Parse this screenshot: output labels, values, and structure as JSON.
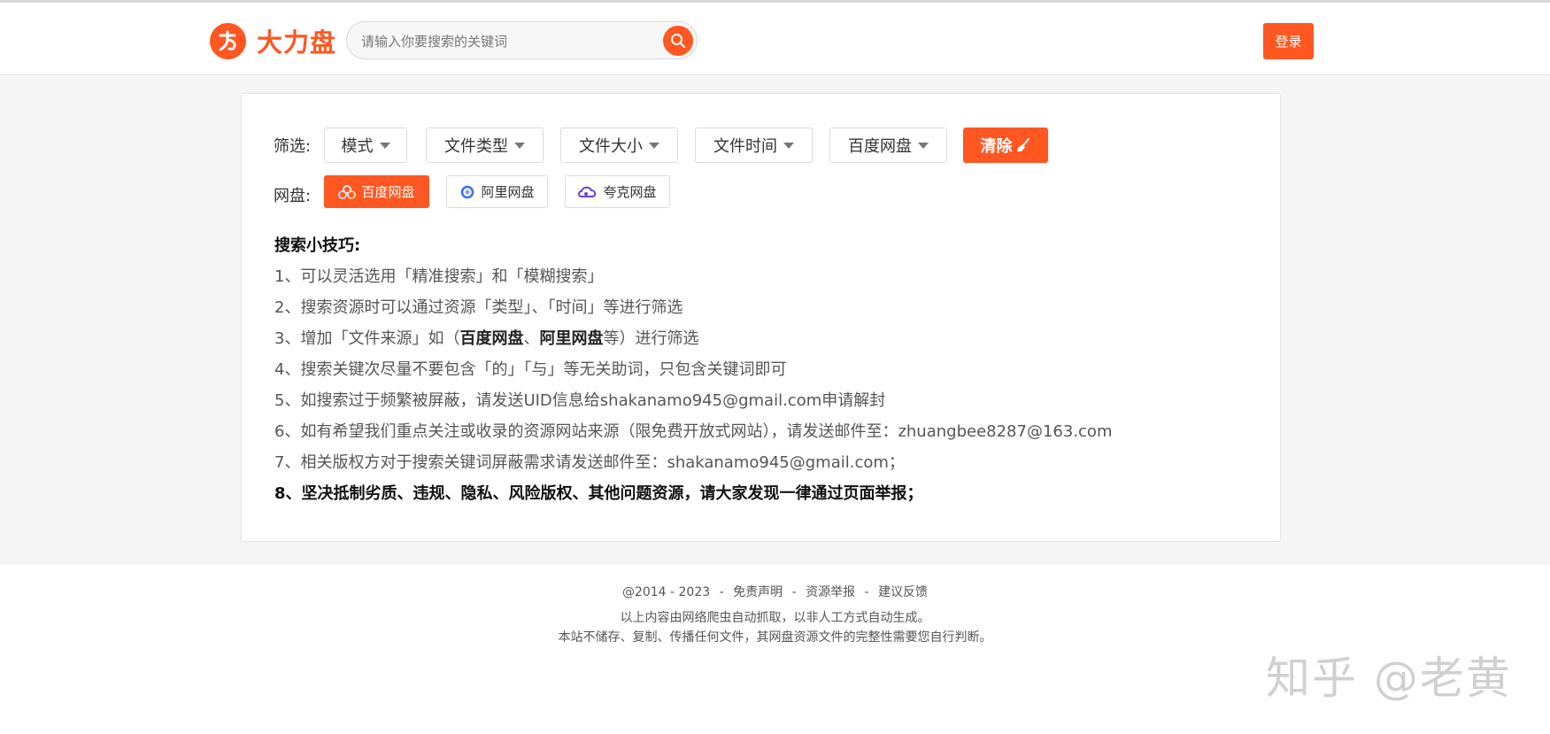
{
  "header": {
    "logo_text": "大力盘",
    "search_placeholder": "请输入你要搜索的关键词",
    "login_label": "登录"
  },
  "filters": {
    "label": "筛选:",
    "dropdowns": [
      "模式",
      "文件类型",
      "文件大小",
      "文件时间",
      "百度网盘"
    ],
    "clear_label": "清除"
  },
  "pan": {
    "label": "网盘:",
    "options": [
      "百度网盘",
      "阿里网盘",
      "夸克网盘"
    ],
    "active": "百度网盘"
  },
  "tips": {
    "title": "搜索小技巧:",
    "items": [
      "1、可以灵活选用「精准搜索」和「模糊搜索」",
      "2、搜索资源时可以通过资源「类型」、「时间」等进行筛选",
      {
        "a": "3、增加「文件来源」如（",
        "b1": "百度网盘",
        "c": "、",
        "b2": "阿里网盘",
        "d": "等）进行筛选"
      },
      "4、搜索关键次尽量不要包含「的」「与」等无关助词，只包含关键词即可",
      "5、如搜索过于频繁被屏蔽，请发送UID信息给shakanamo945@gmail.com申请解封",
      "6、如有希望我们重点关注或收录的资源网站来源（限免费开放式网站），请发送邮件至：zhuangbee8287@163.com",
      "7、相关版权方对于搜索关键词屏蔽需求请发送邮件至：shakanamo945@gmail.com；",
      "8、坚决抵制劣质、违规、隐私、风险版权、其他问题资源，请大家发现一律通过页面举报；"
    ]
  },
  "footer": {
    "copyright": "@2014 - 2023",
    "links": [
      "免责声明",
      "资源举报",
      "建议反馈"
    ],
    "separator": "-",
    "line2": "以上内容由网络爬虫自动抓取，以非人工方式自动生成。",
    "line3": "本站不储存、复制、传播任何文件，其网盘资源文件的完整性需要您自行判断。"
  },
  "watermark": "知乎 @老黄",
  "colors": {
    "accent": "#ff5722"
  }
}
